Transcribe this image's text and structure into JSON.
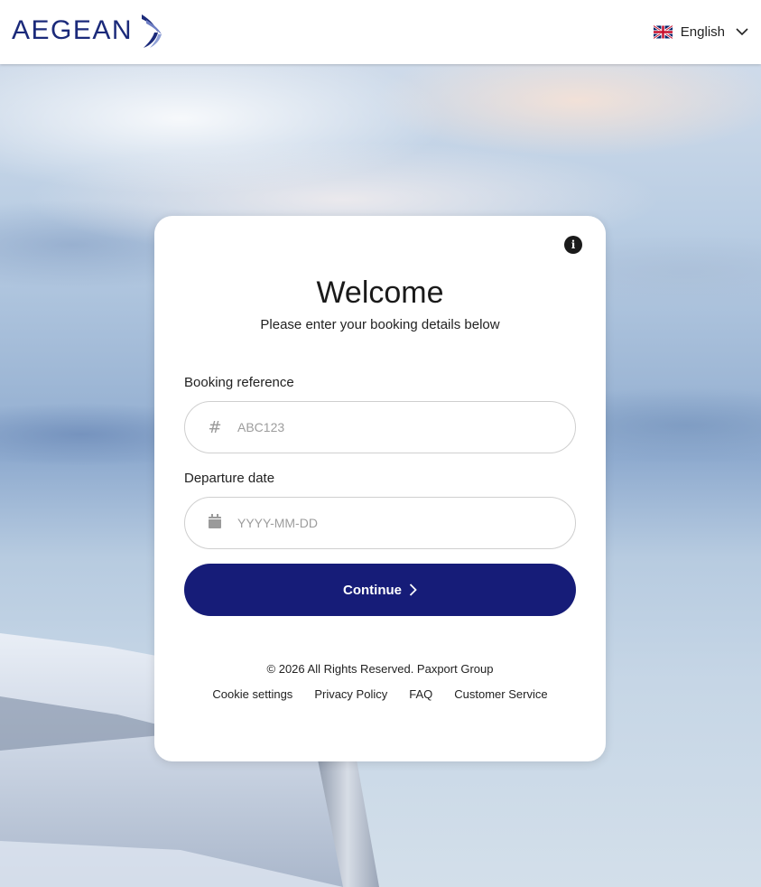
{
  "header": {
    "brand": "AEGEAN",
    "language": {
      "label": "English",
      "flag_icon": "uk-flag-icon"
    }
  },
  "card": {
    "title": "Welcome",
    "subtitle": "Please enter your booking details below",
    "booking_reference": {
      "label": "Booking reference",
      "placeholder": "ABC123",
      "value": "",
      "icon": "hash-icon"
    },
    "departure_date": {
      "label": "Departure date",
      "placeholder": "YYYY-MM-DD",
      "value": "",
      "icon": "calendar-icon"
    },
    "continue_label": "Continue",
    "copyright": "© 2026 All Rights Reserved. Paxport Group",
    "links": {
      "cookie": "Cookie settings",
      "privacy": "Privacy Policy",
      "faq": "FAQ",
      "service": "Customer Service"
    }
  },
  "colors": {
    "brand_navy": "#1b2a7a",
    "button": "#161c78"
  }
}
